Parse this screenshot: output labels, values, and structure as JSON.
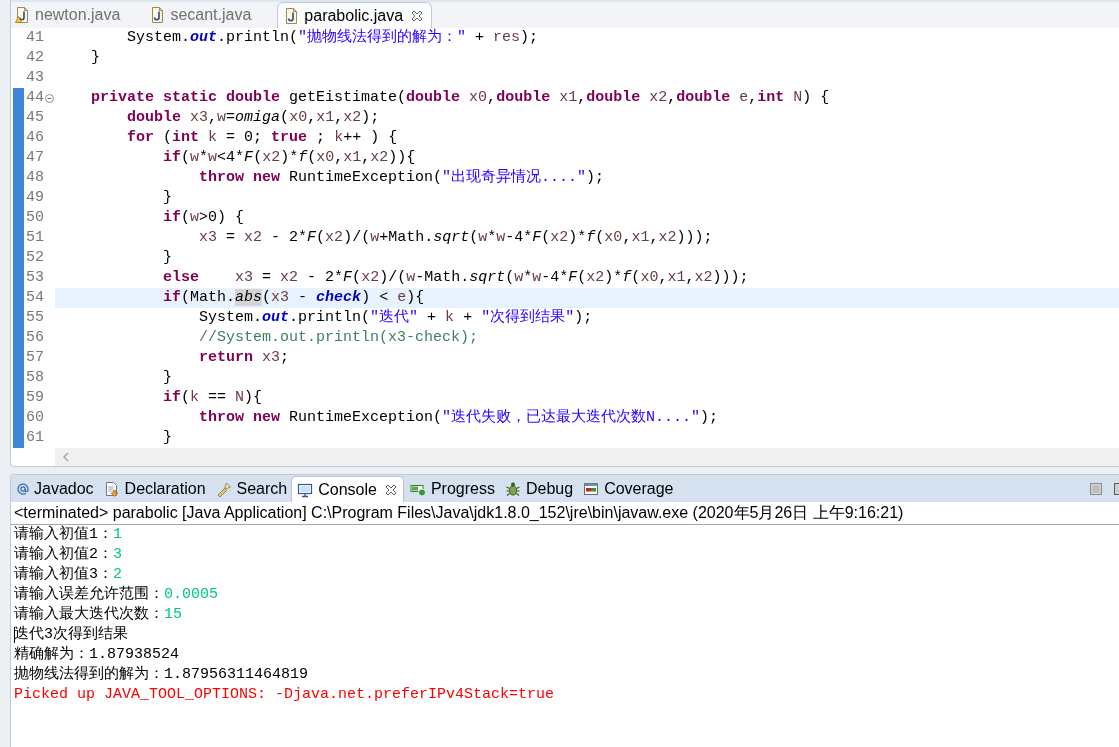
{
  "editor": {
    "tabs": [
      {
        "label": "newton.java",
        "selected": false,
        "warning": true
      },
      {
        "label": "secant.java",
        "selected": false,
        "warning": false
      },
      {
        "label": "parabolic.java",
        "selected": true,
        "warning": false
      }
    ],
    "lines": [
      {
        "number": "41",
        "current": false,
        "in_range": false,
        "tokens": [
          {
            "kind": "plain",
            "text": "        System."
          },
          {
            "kind": "field",
            "text": "out"
          },
          {
            "kind": "plain",
            "text": ".println("
          },
          {
            "kind": "string",
            "text": "\"抛物线法得到的解为：\""
          },
          {
            "kind": "plain",
            "text": " + "
          },
          {
            "kind": "local",
            "text": "res"
          },
          {
            "kind": "plain",
            "text": ");"
          }
        ]
      },
      {
        "number": "42",
        "current": false,
        "in_range": false,
        "tokens": [
          {
            "kind": "plain",
            "text": "    }"
          }
        ]
      },
      {
        "number": "43",
        "current": false,
        "in_range": false
      },
      {
        "number": "44",
        "current": false,
        "in_range": true,
        "expanded": true,
        "tokens": [
          {
            "kind": "keyword",
            "text": "    private static double"
          },
          {
            "kind": "plain",
            "text": " getEistimate("
          },
          {
            "kind": "keyword",
            "text": "double"
          },
          {
            "kind": "local",
            "text": " x0"
          },
          {
            "kind": "plain",
            "text": ","
          },
          {
            "kind": "keyword",
            "text": "double"
          },
          {
            "kind": "local",
            "text": " x1"
          },
          {
            "kind": "plain",
            "text": ","
          },
          {
            "kind": "keyword",
            "text": "double"
          },
          {
            "kind": "local",
            "text": " x2"
          },
          {
            "kind": "plain",
            "text": ","
          },
          {
            "kind": "keyword",
            "text": "double"
          },
          {
            "kind": "local",
            "text": " e"
          },
          {
            "kind": "plain",
            "text": ","
          },
          {
            "kind": "keyword",
            "text": "int"
          },
          {
            "kind": "local",
            "text": " N"
          },
          {
            "kind": "plain",
            "text": ") {"
          }
        ]
      },
      {
        "number": "45",
        "current": false,
        "in_range": true,
        "tokens": [
          {
            "kind": "keyword",
            "text": "        double"
          },
          {
            "kind": "local",
            "text": " x3"
          },
          {
            "kind": "plain",
            "text": ","
          },
          {
            "kind": "local",
            "text": "w"
          },
          {
            "kind": "plain",
            "text": "="
          },
          {
            "kind": "call",
            "text": "omiga"
          },
          {
            "kind": "plain",
            "text": "("
          },
          {
            "kind": "local",
            "text": "x0"
          },
          {
            "kind": "plain",
            "text": ","
          },
          {
            "kind": "local",
            "text": "x1"
          },
          {
            "kind": "plain",
            "text": ","
          },
          {
            "kind": "local",
            "text": "x2"
          },
          {
            "kind": "plain",
            "text": ");"
          }
        ]
      },
      {
        "number": "46",
        "current": false,
        "in_range": true,
        "tokens": [
          {
            "kind": "keyword",
            "text": "        for"
          },
          {
            "kind": "plain",
            "text": " ("
          },
          {
            "kind": "keyword",
            "text": "int"
          },
          {
            "kind": "local",
            "text": " k"
          },
          {
            "kind": "plain",
            "text": " = 0; "
          },
          {
            "kind": "keyword",
            "text": "true"
          },
          {
            "kind": "plain",
            "text": " ; "
          },
          {
            "kind": "local",
            "text": "k"
          },
          {
            "kind": "plain",
            "text": "++ ) {"
          }
        ]
      },
      {
        "number": "47",
        "current": false,
        "in_range": true,
        "tokens": [
          {
            "kind": "keyword",
            "text": "            if"
          },
          {
            "kind": "plain",
            "text": "("
          },
          {
            "kind": "local",
            "text": "w"
          },
          {
            "kind": "plain",
            "text": "*"
          },
          {
            "kind": "local",
            "text": "w"
          },
          {
            "kind": "plain",
            "text": "<4*"
          },
          {
            "kind": "call",
            "text": "F"
          },
          {
            "kind": "plain",
            "text": "("
          },
          {
            "kind": "local",
            "text": "x2"
          },
          {
            "kind": "plain",
            "text": ")*"
          },
          {
            "kind": "call",
            "text": "f"
          },
          {
            "kind": "plain",
            "text": "("
          },
          {
            "kind": "local",
            "text": "x0"
          },
          {
            "kind": "plain",
            "text": ","
          },
          {
            "kind": "local",
            "text": "x1"
          },
          {
            "kind": "plain",
            "text": ","
          },
          {
            "kind": "local",
            "text": "x2"
          },
          {
            "kind": "plain",
            "text": ")){"
          }
        ]
      },
      {
        "number": "48",
        "current": false,
        "in_range": true,
        "tokens": [
          {
            "kind": "keyword",
            "text": "                throw new"
          },
          {
            "kind": "plain",
            "text": " RuntimeException("
          },
          {
            "kind": "string",
            "text": "\"出现奇异情况....\""
          },
          {
            "kind": "plain",
            "text": ");"
          }
        ]
      },
      {
        "number": "49",
        "current": false,
        "in_range": true,
        "tokens": [
          {
            "kind": "plain",
            "text": "            }"
          }
        ]
      },
      {
        "number": "50",
        "current": false,
        "in_range": true,
        "tokens": [
          {
            "kind": "keyword",
            "text": "            if"
          },
          {
            "kind": "plain",
            "text": "("
          },
          {
            "kind": "local",
            "text": "w"
          },
          {
            "kind": "plain",
            "text": ">0) {"
          }
        ]
      },
      {
        "number": "51",
        "current": false,
        "in_range": true,
        "tokens": [
          {
            "kind": "local",
            "text": "                x3"
          },
          {
            "kind": "plain",
            "text": " = "
          },
          {
            "kind": "local",
            "text": "x2"
          },
          {
            "kind": "plain",
            "text": " - 2*"
          },
          {
            "kind": "call",
            "text": "F"
          },
          {
            "kind": "plain",
            "text": "("
          },
          {
            "kind": "local",
            "text": "x2"
          },
          {
            "kind": "plain",
            "text": ")/("
          },
          {
            "kind": "local",
            "text": "w"
          },
          {
            "kind": "plain",
            "text": "+Math."
          },
          {
            "kind": "call",
            "text": "sqrt"
          },
          {
            "kind": "plain",
            "text": "("
          },
          {
            "kind": "local",
            "text": "w"
          },
          {
            "kind": "plain",
            "text": "*"
          },
          {
            "kind": "local",
            "text": "w"
          },
          {
            "kind": "plain",
            "text": "-4*"
          },
          {
            "kind": "call",
            "text": "F"
          },
          {
            "kind": "plain",
            "text": "("
          },
          {
            "kind": "local",
            "text": "x2"
          },
          {
            "kind": "plain",
            "text": ")*"
          },
          {
            "kind": "call",
            "text": "f"
          },
          {
            "kind": "plain",
            "text": "("
          },
          {
            "kind": "local",
            "text": "x0"
          },
          {
            "kind": "plain",
            "text": ","
          },
          {
            "kind": "local",
            "text": "x1"
          },
          {
            "kind": "plain",
            "text": ","
          },
          {
            "kind": "local",
            "text": "x2"
          },
          {
            "kind": "plain",
            "text": ")));"
          }
        ]
      },
      {
        "number": "52",
        "current": false,
        "in_range": true,
        "tokens": [
          {
            "kind": "plain",
            "text": "            }"
          }
        ]
      },
      {
        "number": "53",
        "current": false,
        "in_range": true,
        "tokens": [
          {
            "kind": "keyword",
            "text": "            else"
          },
          {
            "kind": "local",
            "text": "    x3"
          },
          {
            "kind": "plain",
            "text": " = "
          },
          {
            "kind": "local",
            "text": "x2"
          },
          {
            "kind": "plain",
            "text": " - 2*"
          },
          {
            "kind": "call",
            "text": "F"
          },
          {
            "kind": "plain",
            "text": "("
          },
          {
            "kind": "local",
            "text": "x2"
          },
          {
            "kind": "plain",
            "text": ")/("
          },
          {
            "kind": "local",
            "text": "w"
          },
          {
            "kind": "plain",
            "text": "-Math."
          },
          {
            "kind": "call",
            "text": "sqrt"
          },
          {
            "kind": "plain",
            "text": "("
          },
          {
            "kind": "local",
            "text": "w"
          },
          {
            "kind": "plain",
            "text": "*"
          },
          {
            "kind": "local",
            "text": "w"
          },
          {
            "kind": "plain",
            "text": "-4*"
          },
          {
            "kind": "call",
            "text": "F"
          },
          {
            "kind": "plain",
            "text": "("
          },
          {
            "kind": "local",
            "text": "x2"
          },
          {
            "kind": "plain",
            "text": ")*"
          },
          {
            "kind": "call",
            "text": "f"
          },
          {
            "kind": "plain",
            "text": "("
          },
          {
            "kind": "local",
            "text": "x0"
          },
          {
            "kind": "plain",
            "text": ","
          },
          {
            "kind": "local",
            "text": "x1"
          },
          {
            "kind": "plain",
            "text": ","
          },
          {
            "kind": "local",
            "text": "x2"
          },
          {
            "kind": "plain",
            "text": ")));"
          }
        ]
      },
      {
        "number": "54",
        "current": true,
        "in_range": true,
        "tokens": [
          {
            "kind": "keyword",
            "text": "            if"
          },
          {
            "kind": "plain",
            "text": "(Math."
          },
          {
            "kind": "occurrence",
            "text": "abs"
          },
          {
            "kind": "plain",
            "text": "("
          },
          {
            "kind": "local",
            "text": "x3"
          },
          {
            "kind": "plain",
            "text": " - "
          },
          {
            "kind": "field",
            "text": "check"
          },
          {
            "kind": "plain",
            "text": ") < "
          },
          {
            "kind": "local",
            "text": "e"
          },
          {
            "kind": "plain",
            "text": "){"
          }
        ]
      },
      {
        "number": "55",
        "current": false,
        "in_range": true,
        "tokens": [
          {
            "kind": "plain",
            "text": "                System."
          },
          {
            "kind": "field",
            "text": "out"
          },
          {
            "kind": "plain",
            "text": ".println("
          },
          {
            "kind": "string",
            "text": "\"迭代\""
          },
          {
            "kind": "plain",
            "text": " + "
          },
          {
            "kind": "local",
            "text": "k"
          },
          {
            "kind": "plain",
            "text": " + "
          },
          {
            "kind": "string",
            "text": "\"次得到结果\""
          },
          {
            "kind": "plain",
            "text": ");"
          }
        ]
      },
      {
        "number": "56",
        "current": false,
        "in_range": true,
        "tokens": [
          {
            "kind": "comment",
            "text": "                //System.out.println(x3-check);"
          }
        ]
      },
      {
        "number": "57",
        "current": false,
        "in_range": true,
        "tokens": [
          {
            "kind": "keyword",
            "text": "                return"
          },
          {
            "kind": "local",
            "text": " x3"
          },
          {
            "kind": "plain",
            "text": ";"
          }
        ]
      },
      {
        "number": "58",
        "current": false,
        "in_range": true,
        "tokens": [
          {
            "kind": "plain",
            "text": "            }"
          }
        ]
      },
      {
        "number": "59",
        "current": false,
        "in_range": true,
        "tokens": [
          {
            "kind": "keyword",
            "text": "            if"
          },
          {
            "kind": "plain",
            "text": "("
          },
          {
            "kind": "local",
            "text": "k"
          },
          {
            "kind": "plain",
            "text": " == "
          },
          {
            "kind": "local",
            "text": "N"
          },
          {
            "kind": "plain",
            "text": "){"
          }
        ]
      },
      {
        "number": "60",
        "current": false,
        "in_range": true,
        "tokens": [
          {
            "kind": "keyword",
            "text": "                throw new"
          },
          {
            "kind": "plain",
            "text": " RuntimeException("
          },
          {
            "kind": "string",
            "text": "\"迭代失败，已达最大迭代次数N....\""
          },
          {
            "kind": "plain",
            "text": ");"
          }
        ]
      },
      {
        "number": "61",
        "current": false,
        "in_range": true,
        "tokens": [
          {
            "kind": "plain",
            "text": "            }"
          }
        ]
      }
    ]
  },
  "console_view": {
    "tabs": [
      {
        "label": "Javadoc",
        "selected": false
      },
      {
        "label": "Declaration",
        "selected": false
      },
      {
        "label": "Search",
        "selected": false
      },
      {
        "label": "Console",
        "selected": true
      },
      {
        "label": "Progress",
        "selected": false
      },
      {
        "label": "Debug",
        "selected": false
      },
      {
        "label": "Coverage",
        "selected": false
      }
    ],
    "status": "<terminated> parabolic [Java Application] C:\\Program Files\\Java\\jdk1.8.0_152\\jre\\bin\\javaw.exe (2020年5月26日 上午9:16:21)",
    "lines": [
      {
        "kind": "stdout",
        "text": "请输入初值1：",
        "input": "1",
        "caret": false
      },
      {
        "kind": "stdout",
        "text": "请输入初值2：",
        "input": "3",
        "caret": false
      },
      {
        "kind": "stdout",
        "text": "请输入初值3：",
        "input": "2",
        "caret": false
      },
      {
        "kind": "stdout",
        "text": "请输入误差允许范围：",
        "input": "0.0005",
        "caret": false
      },
      {
        "kind": "stdout",
        "text": "请输入最大迭代次数：",
        "input": "15",
        "caret": false
      },
      {
        "kind": "stdout",
        "text": "迭代3次得到结果",
        "caret": true
      },
      {
        "kind": "stdout",
        "text": "精确解为：1.87938524",
        "caret": false
      },
      {
        "kind": "stdout",
        "text": "抛物线法得到的解为：1.87956311464819",
        "caret": false
      },
      {
        "kind": "stderr",
        "text": "Picked up JAVA_TOOL_OPTIONS: -Djava.net.preferIPv4Stack=true",
        "caret": false
      }
    ]
  }
}
